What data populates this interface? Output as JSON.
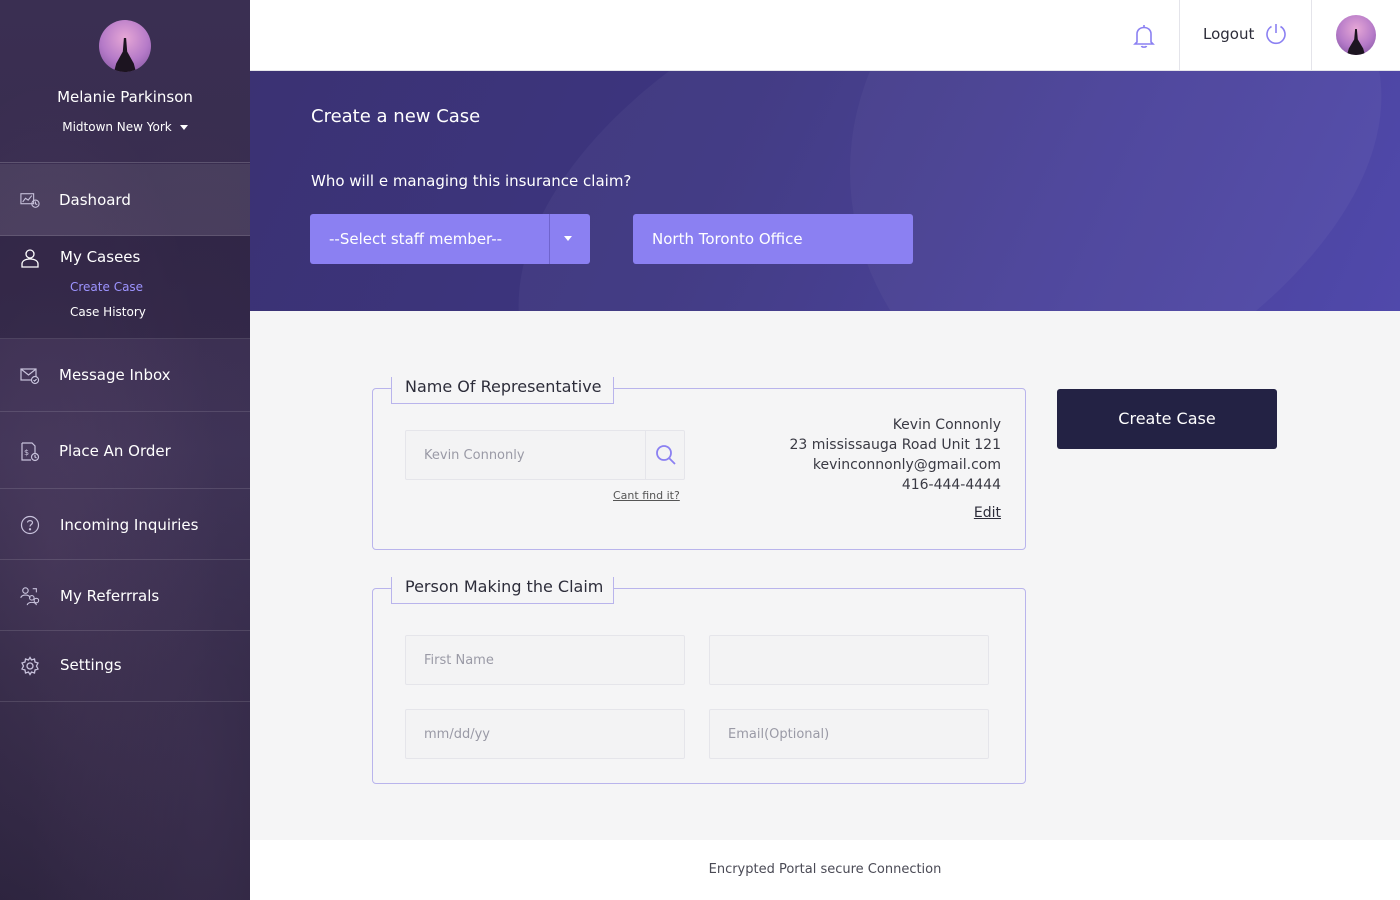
{
  "user": {
    "name": "Melanie Parkinson",
    "location": "Midtown New York"
  },
  "sidebar": {
    "items": [
      {
        "label": "Dashoard",
        "icon": "dashboard-icon"
      },
      {
        "label": "My Casees",
        "icon": "user-icon",
        "subitems": [
          {
            "label": "Create Case",
            "active": true
          },
          {
            "label": "Case History",
            "active": false
          }
        ]
      },
      {
        "label": "Message Inbox",
        "icon": "mail-icon"
      },
      {
        "label": "Place An Order",
        "icon": "order-icon"
      },
      {
        "label": "Incoming Inquiries",
        "icon": "question-icon"
      },
      {
        "label": "My Referrrals",
        "icon": "referrals-icon"
      },
      {
        "label": "Settings",
        "icon": "gear-icon"
      }
    ]
  },
  "header": {
    "logout_label": "Logout"
  },
  "banner": {
    "title": "Create a new Case",
    "question": "Who will e managing this insurance claim?",
    "staff_select": "--Select staff member--",
    "office": "North Toronto Office"
  },
  "representative": {
    "legend": "Name Of Representative",
    "search_placeholder": "Kevin Connonly",
    "cant_find": "Cant find it?",
    "name": "Kevin Connonly",
    "address": "23 mississauga Road Unit 121",
    "email": "kevinconnonly@gmail.com",
    "phone": "416-444-4444",
    "edit_label": "Edit"
  },
  "claimant": {
    "legend": "Person Making the Claim",
    "first_name_placeholder": "First Name",
    "last_name_placeholder": "",
    "date_placeholder": "mm/dd/yy",
    "email_placeholder": "Email(Optional)"
  },
  "create_button": "Create Case",
  "footer": "Encrypted Portal secure Connection",
  "colors": {
    "accent": "#8b80f2",
    "dark_button": "#232244",
    "sidebar_active_sub": "#9d94ff"
  }
}
